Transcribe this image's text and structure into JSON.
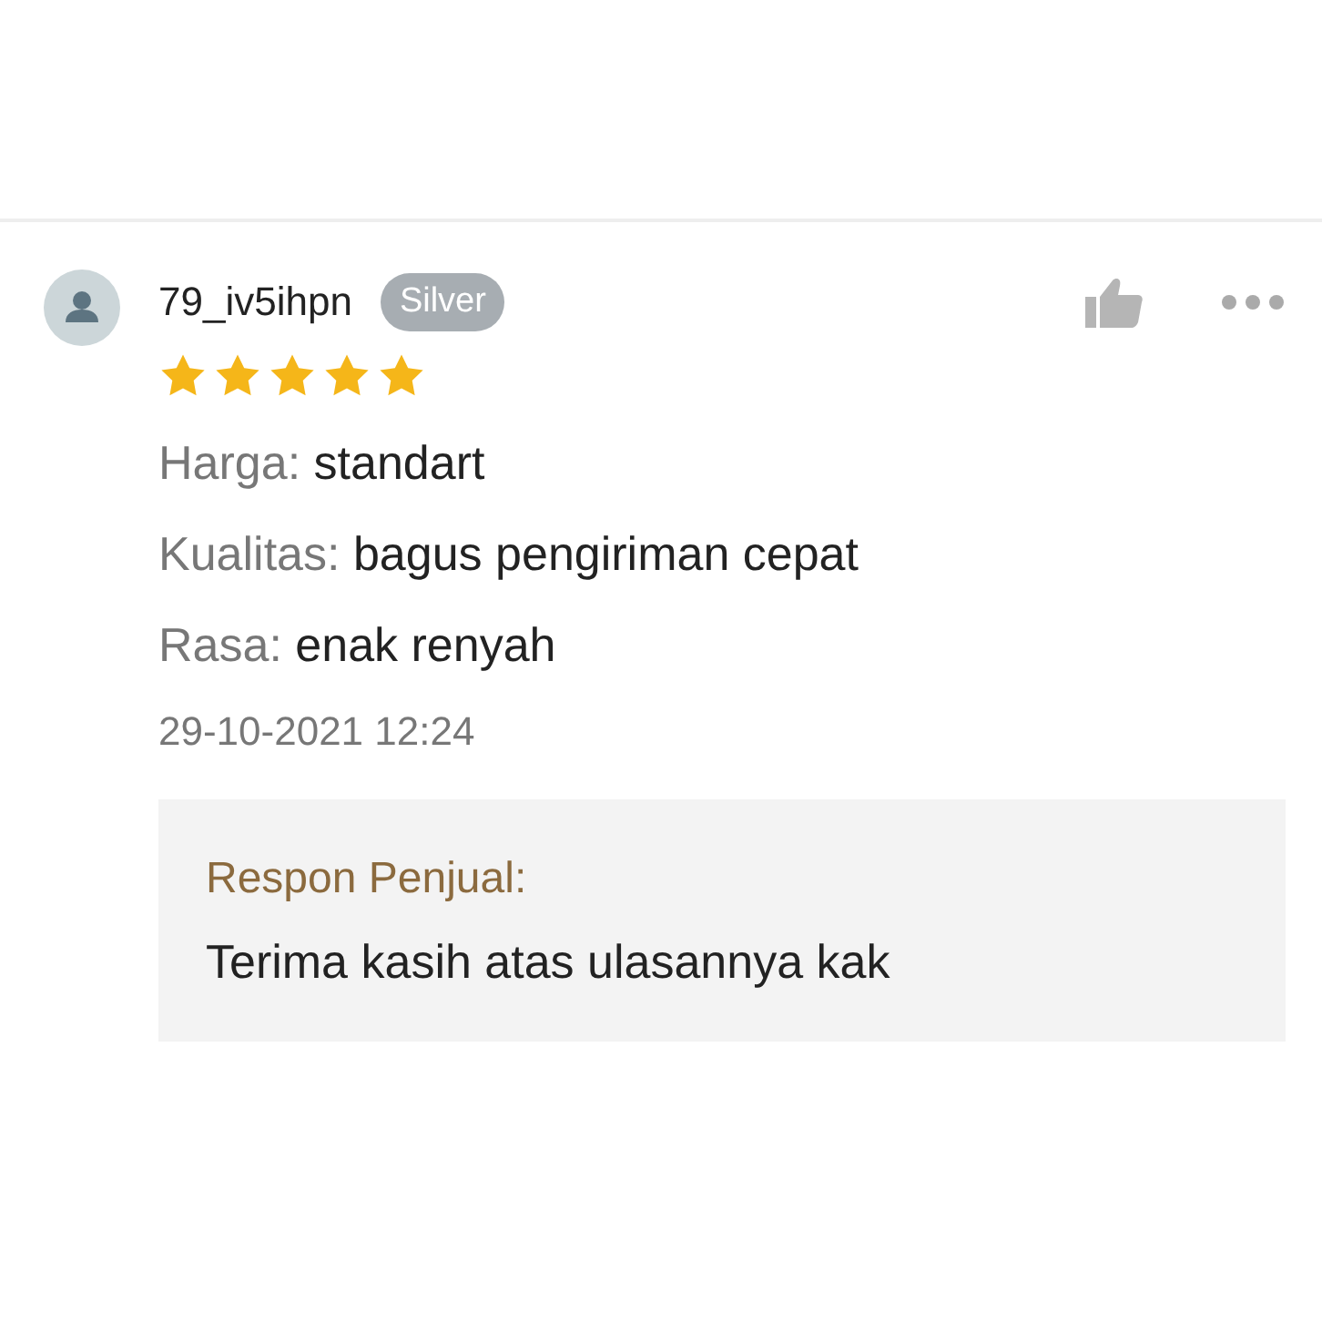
{
  "review": {
    "username": "79_iv5ihpn",
    "badge": "Silver",
    "stars": 5,
    "attributes": [
      {
        "label": "Harga:",
        "value": "standart"
      },
      {
        "label": "Kualitas:",
        "value": "bagus pengiriman cepat"
      },
      {
        "label": "Rasa:",
        "value": "enak renyah"
      }
    ],
    "date": "29-10-2021 12:24",
    "seller_response": {
      "title": "Respon Penjual:",
      "text": "Terima kasih atas ulasannya kak"
    }
  }
}
